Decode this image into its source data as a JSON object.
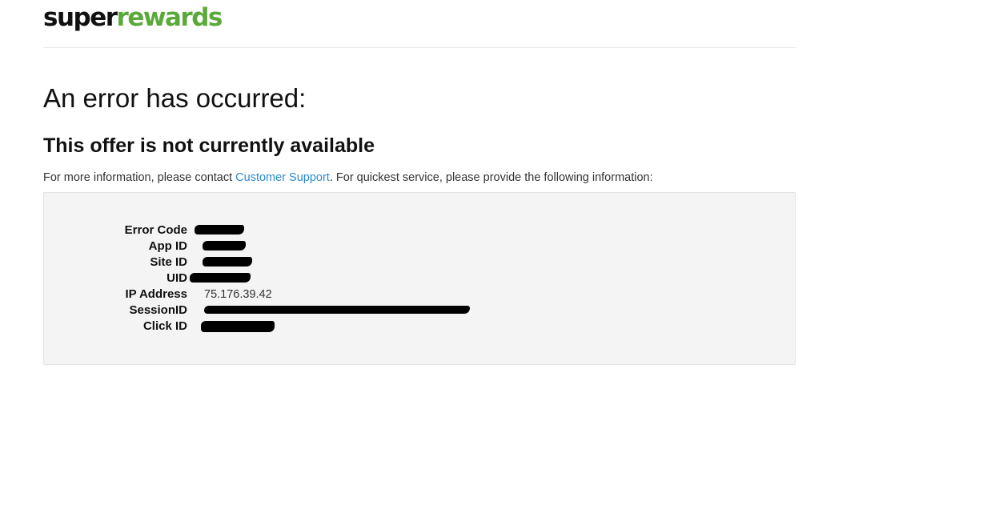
{
  "logo": {
    "part1": "super",
    "part2": "rewards",
    "brand_green": "#5aa939"
  },
  "heading": "An error has occurred:",
  "subheading": "This offer is not currently available",
  "info": {
    "prefix": "For more information, please contact ",
    "link": "Customer Support",
    "suffix": ". For quickest service, please provide the following information:",
    "link_color": "#2b8ccf"
  },
  "details": [
    {
      "label": "Error Code",
      "value": ""
    },
    {
      "label": "App ID",
      "value": ""
    },
    {
      "label": "Site ID",
      "value": ""
    },
    {
      "label": "UID",
      "value": ""
    },
    {
      "label": "IP Address",
      "value": "75.176.39.42"
    },
    {
      "label": "SessionID",
      "value": ""
    },
    {
      "label": "Click ID",
      "value": ""
    }
  ]
}
